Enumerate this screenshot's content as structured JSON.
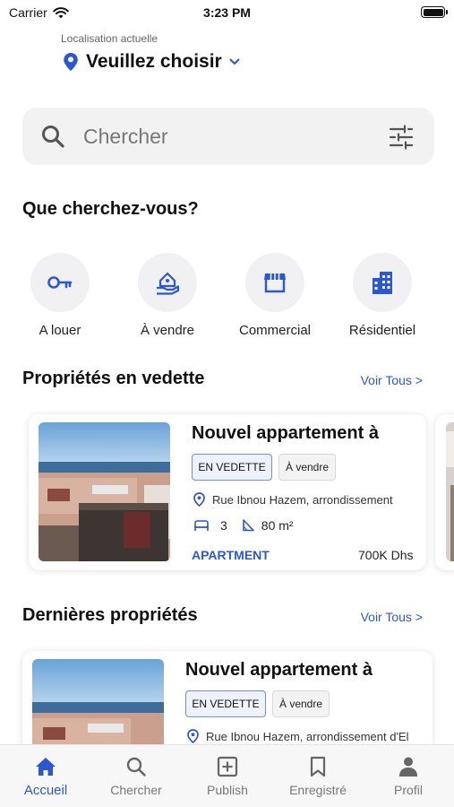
{
  "status_bar": {
    "carrier": "Carrier",
    "time": "3:23 PM"
  },
  "location": {
    "caption": "Localisation actuelle",
    "value": "Veuillez choisir"
  },
  "search": {
    "placeholder": "Chercher"
  },
  "categories_section": {
    "title": "Que cherchez-vous?",
    "items": [
      {
        "label": "A louer",
        "icon": "key-icon"
      },
      {
        "label": "À vendre",
        "icon": "house-hand-icon"
      },
      {
        "label": "Commercial",
        "icon": "storefront-icon"
      },
      {
        "label": "Résidentiel",
        "icon": "building-icon"
      }
    ]
  },
  "featured": {
    "title": "Propriétés en vedette",
    "see_all": "Voir Tous >",
    "card": {
      "title": "Nouvel appartement à",
      "badge_featured": "EN VEDETTE",
      "badge_status": "À vendre",
      "address": "Rue Ibnou Hazem, arrondissement",
      "bedrooms": "3",
      "area": "80 m²",
      "type": "APARTMENT",
      "price": "700K Dhs"
    }
  },
  "latest": {
    "title": "Dernières propriétés",
    "see_all": "Voir Tous >",
    "card": {
      "title": "Nouvel appartement à",
      "badge_featured": "EN VEDETTE",
      "badge_status": "À vendre",
      "address": "Rue Ibnou Hazem, arrondissement d'El"
    }
  },
  "tab_bar": {
    "items": [
      {
        "label": "Accueil",
        "icon": "home-icon",
        "active": true
      },
      {
        "label": "Chercher",
        "icon": "search-icon",
        "active": false
      },
      {
        "label": "Publish",
        "icon": "add-square-icon",
        "active": false
      },
      {
        "label": "Enregistré",
        "icon": "bookmark-icon",
        "active": false
      },
      {
        "label": "Profil",
        "icon": "person-icon",
        "active": false
      }
    ]
  },
  "colors": {
    "accent": "#2c57d4",
    "text": "#111111",
    "muted": "#777777",
    "surface": "#f2f2f3"
  }
}
